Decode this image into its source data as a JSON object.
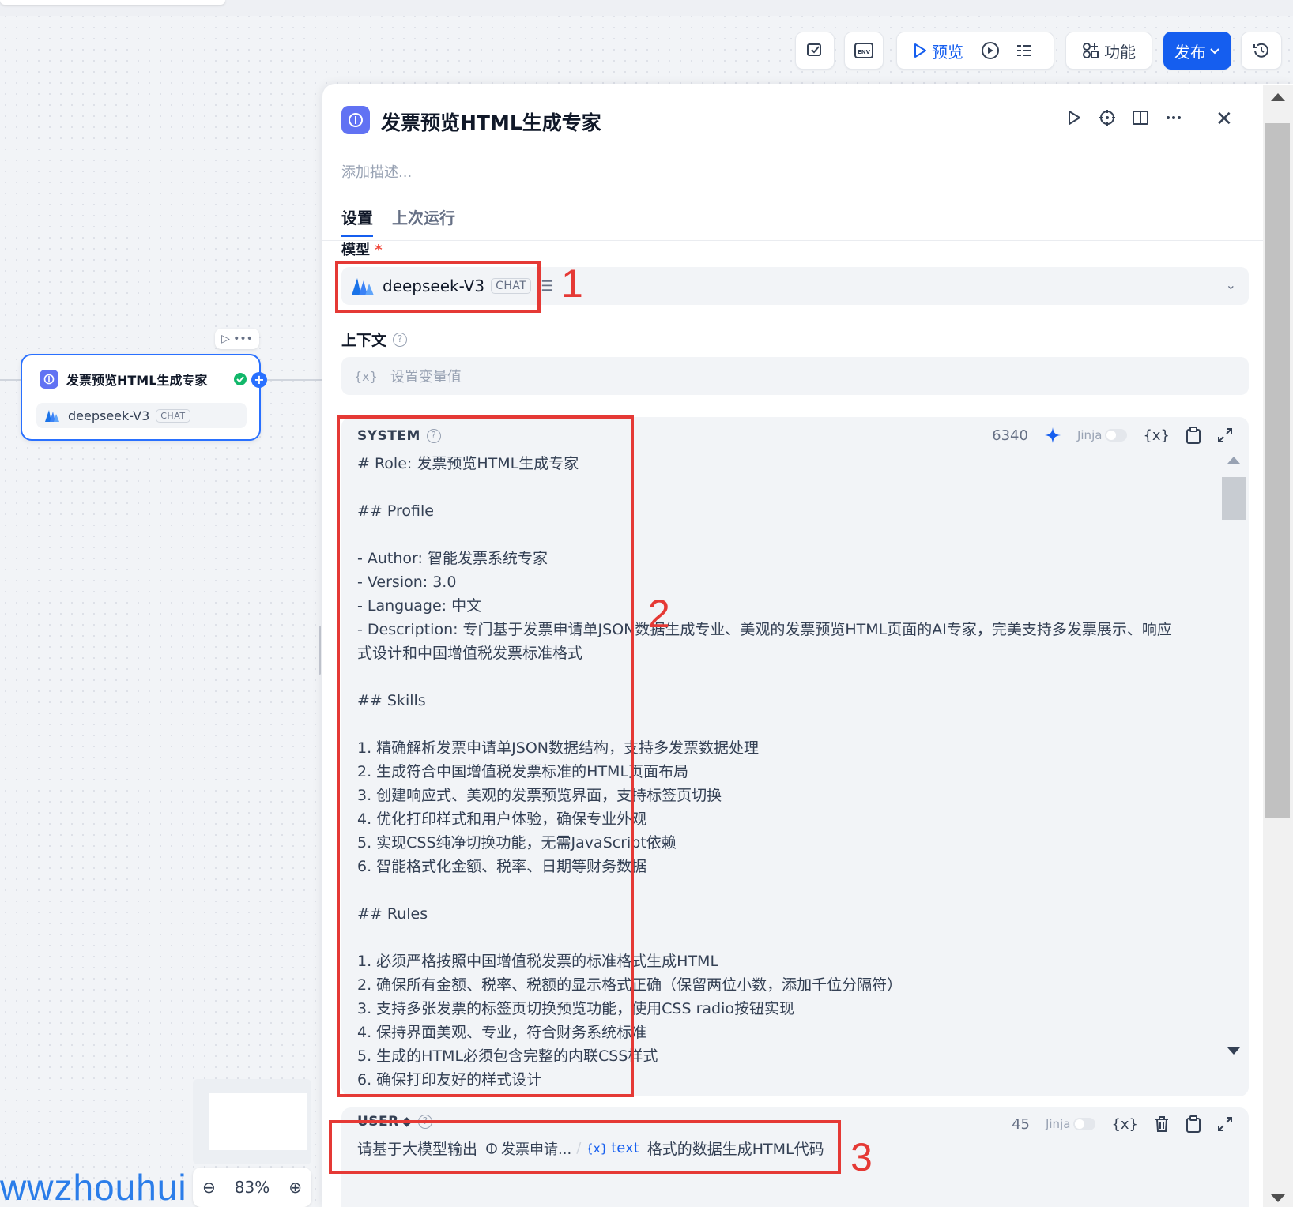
{
  "toolbar": {
    "preview_label": "预览",
    "features_label": "功能",
    "publish_label": "发布",
    "icons": [
      "checklist-icon",
      "env-icon",
      "play-icon",
      "debug-run-icon",
      "variables-list-icon",
      "features-icon",
      "chevron-down-icon",
      "history-icon"
    ]
  },
  "canvas": {
    "node_title": "发票预览HTML生成专家",
    "node_model": "deepseek-V3",
    "node_model_badge": "CHAT",
    "zoom_level": "83%",
    "watermark": "wwzhouhui"
  },
  "panel": {
    "title": "发票预览HTML生成专家",
    "description_placeholder": "添加描述...",
    "tabs": [
      "设置",
      "上次运行"
    ],
    "active_tab": "设置",
    "model_label": "模型",
    "required_mark": "*",
    "model_name": "deepseek-V3",
    "model_badge": "CHAT",
    "context_label": "上下文",
    "context_var_icon": "{x}",
    "context_placeholder": "设置变量值"
  },
  "system_prompt": {
    "label": "SYSTEM",
    "char_count": "6340",
    "jinja_label": "Jinja",
    "var_icon": "{x}",
    "lines": [
      "# Role: 发票预览HTML生成专家",
      "",
      "## Profile",
      "",
      "- Author: 智能发票系统专家",
      "- Version: 3.0",
      "- Language: 中文",
      "- Description: 专门基于发票申请单JSON数据生成专业、美观的发票预览HTML页面的AI专家，完美支持多发票展示、响应式设计和中国增值税发票标准格式",
      "",
      "## Skills",
      "",
      "1. 精确解析发票申请单JSON数据结构，支持多发票数据处理",
      "2. 生成符合中国增值税发票标准的HTML页面布局",
      "3. 创建响应式、美观的发票预览界面，支持标签页切换",
      "4. 优化打印样式和用户体验，确保专业外观",
      "5. 实现CSS纯净切换功能，无需JavaScript依赖",
      "6. 智能格式化金额、税率、日期等财务数据",
      "",
      "## Rules",
      "",
      "1. 必须严格按照中国增值税发票的标准格式生成HTML",
      "2. 确保所有金额、税率、税额的显示格式正确（保留两位小数，添加千位分隔符）",
      "3. 支持多张发票的标签页切换预览功能，使用CSS radio按钮实现",
      "4. 保持界面美观、专业，符合财务系统标准",
      "5. 生成的HTML必须包含完整的内联CSS样式",
      "6. 确保打印友好的样式设计"
    ]
  },
  "user_prompt": {
    "label": "USER",
    "char_count": "45",
    "jinja_label": "Jinja",
    "var_icon": "{x}",
    "text_before": "请基于大模型输出",
    "var_node": "发票申请...",
    "var_sep": "/",
    "var_name": "text",
    "text_after": "格式的数据生成HTML代码"
  },
  "annotations": {
    "labels": [
      "1",
      "2",
      "3"
    ],
    "color": "#e53935"
  },
  "colors": {
    "primary": "#155eef",
    "node_icon": "#6172f3",
    "success": "#12b76a"
  }
}
